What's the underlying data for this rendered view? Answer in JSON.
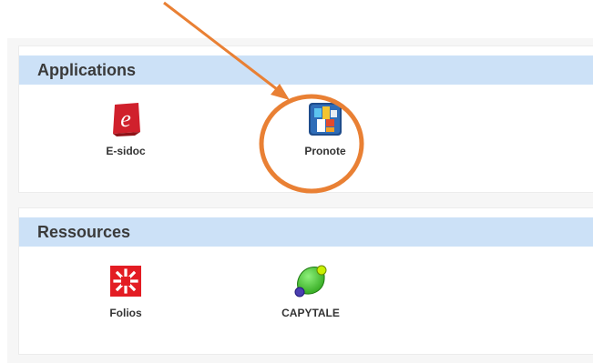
{
  "applications": {
    "title": "Applications",
    "items": [
      {
        "label": "E-sidoc",
        "icon": "e-sidoc-icon"
      },
      {
        "label": "Pronote",
        "icon": "pronote-icon"
      }
    ]
  },
  "ressources": {
    "title": "Ressources",
    "items": [
      {
        "label": "Folios",
        "icon": "folios-icon"
      },
      {
        "label": "CAPYTALE",
        "icon": "capytale-icon"
      }
    ]
  },
  "colors": {
    "header_bg": "#cce1f7",
    "annotation": "#e98034",
    "esidoc": "#d0202c",
    "folios": "#e31c23",
    "capytale": "#3fc22a"
  }
}
